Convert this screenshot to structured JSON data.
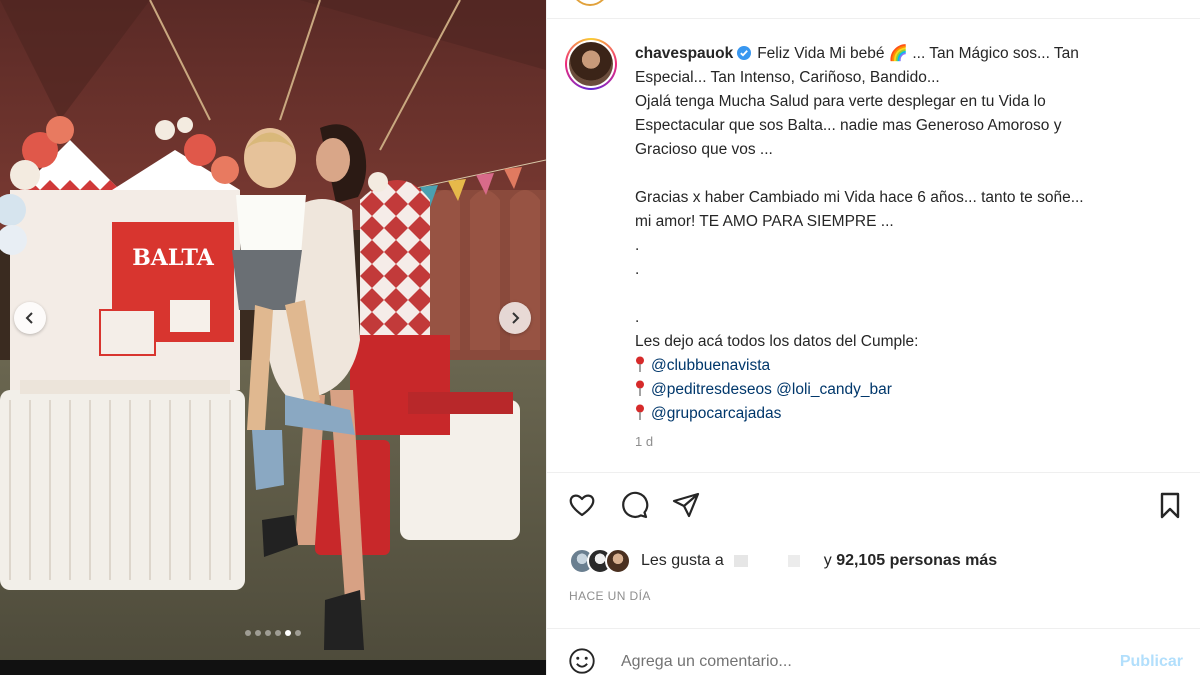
{
  "post": {
    "username": "chavespauok",
    "caption_lines": [
      {
        "type": "first",
        "text": "Feliz Vida Mi bebé 🌈 ... Tan Mágico sos... Tan"
      },
      {
        "type": "text",
        "text": "Especial... Tan Intenso, Cariñoso, Bandido..."
      },
      {
        "type": "text",
        "text": "Ojalá tenga Mucha Salud para verte desplegar en tu Vida lo"
      },
      {
        "type": "text",
        "text": "Espectacular que sos Balta... nadie mas Generoso Amoroso y"
      },
      {
        "type": "text",
        "text": "Gracioso que vos ..."
      },
      {
        "type": "blank",
        "text": ""
      },
      {
        "type": "text",
        "text": "Gracias x haber Cambiado mi Vida hace 6 años... tanto te soñe..."
      },
      {
        "type": "text",
        "text": "mi amor! TE AMO PARA SIEMPRE ..."
      },
      {
        "type": "text",
        "text": "."
      },
      {
        "type": "text",
        "text": "."
      },
      {
        "type": "blank",
        "text": ""
      },
      {
        "type": "text",
        "text": "."
      },
      {
        "type": "text",
        "text": "Les dejo acá todos los datos del Cumple:"
      }
    ],
    "mention_lines": [
      [
        "@clubbuenavista"
      ],
      [
        "@peditresdeseos",
        "@loli_candy_bar"
      ],
      [
        "@grupocarcajadas"
      ]
    ],
    "caption_age": "1 d",
    "likes_prefix": "Les gusta a",
    "likes_count_text": "92,105 personas más",
    "likes_joiner": "y",
    "post_date": "HACE UN DÍA"
  },
  "photo": {
    "sign_text": "BALTA",
    "carousel_dots": 6,
    "active_dot": 4
  },
  "comment": {
    "placeholder": "Agrega un comentario...",
    "publish_label": "Publicar"
  },
  "icons": [
    "chevron-left-icon",
    "chevron-right-icon",
    "heart-icon",
    "comment-icon",
    "share-icon",
    "bookmark-icon",
    "emoji-icon",
    "verified-icon",
    "pin-icon"
  ],
  "colors": {
    "mention": "#00376b",
    "publish": "#b2dffc",
    "muted": "#8e8e8e",
    "verified": "#3897f0"
  }
}
